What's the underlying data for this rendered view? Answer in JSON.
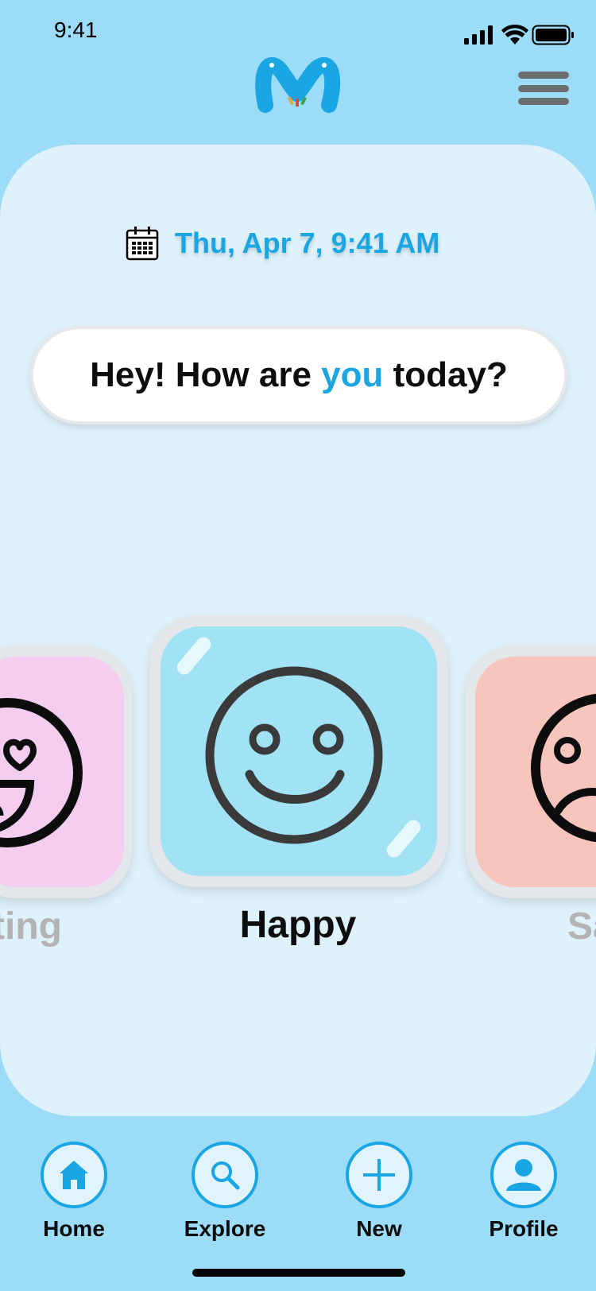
{
  "status_bar": {
    "time": "9:41"
  },
  "header": {
    "logo_icon": "m-logo-icon",
    "menu_icon": "hamburger-menu-icon"
  },
  "date_row": {
    "icon": "calendar-icon",
    "text": "Thu, Apr 7, 9:41 AM"
  },
  "greeting": {
    "before": "Hey! How are ",
    "highlight": "you",
    "after": " today?"
  },
  "moods": {
    "left": {
      "label": "ting",
      "icon": "heart-eyes-face-icon"
    },
    "center": {
      "label": "Happy",
      "icon": "smiley-face-icon"
    },
    "right": {
      "label": "Sa",
      "icon": "sad-face-icon"
    }
  },
  "tabs": [
    {
      "label": "Home",
      "icon": "home-icon"
    },
    {
      "label": "Explore",
      "icon": "search-icon"
    },
    {
      "label": "New",
      "icon": "plus-icon"
    },
    {
      "label": "Profile",
      "icon": "user-icon"
    }
  ],
  "colors": {
    "background": "#9cdcf6",
    "card": "#dff2fb",
    "accent": "#19a6e3",
    "happy_tile": "#a1e3f4",
    "loving_tile": "#f5cdf1",
    "sad_tile": "#f8c5bc"
  }
}
